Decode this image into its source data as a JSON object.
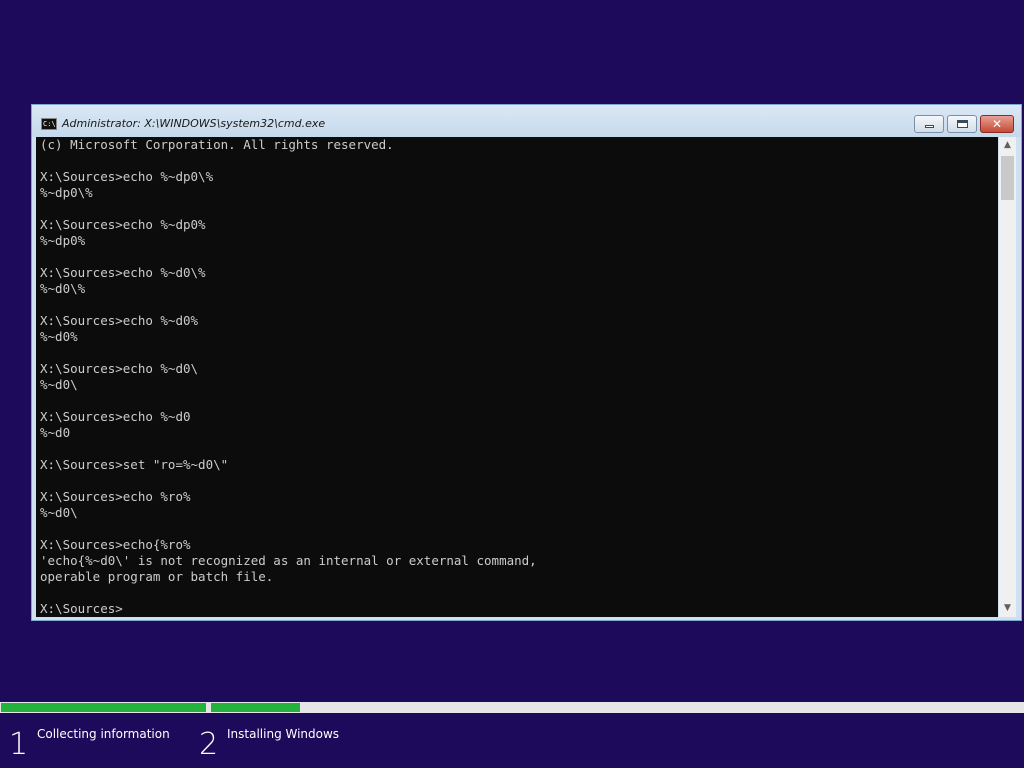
{
  "window": {
    "title": "Administrator: X:\\WINDOWS\\system32\\cmd.exe",
    "icon": "cmd-console-icon",
    "icon_text": "C:\\",
    "buttons": {
      "minimize": "minimize-icon",
      "maximize": "maximize-icon",
      "close_glyph": "✕"
    }
  },
  "console": {
    "lines": [
      "(c) Microsoft Corporation. All rights reserved.",
      "",
      "X:\\Sources>echo %~dp0\\%",
      "%~dp0\\%",
      "",
      "X:\\Sources>echo %~dp0%",
      "%~dp0%",
      "",
      "X:\\Sources>echo %~d0\\%",
      "%~d0\\%",
      "",
      "X:\\Sources>echo %~d0%",
      "%~d0%",
      "",
      "X:\\Sources>echo %~d0\\",
      "%~d0\\",
      "",
      "X:\\Sources>echo %~d0",
      "%~d0",
      "",
      "X:\\Sources>set \"ro=%~d0\\\"",
      "",
      "X:\\Sources>echo %ro%",
      "%~d0\\",
      "",
      "X:\\Sources>echo{%ro%",
      "'echo{%~d0\\' is not recognized as an internal or external command,",
      "operable program or batch file.",
      "",
      "X:\\Sources>"
    ]
  },
  "scrollbar": {
    "up_glyph": "▲",
    "down_glyph": "▼"
  },
  "setup": {
    "steps": [
      {
        "number": "1",
        "label": "Collecting information",
        "progress": 1.0
      },
      {
        "number": "2",
        "label": "Installing Windows",
        "progress": 0.11
      }
    ],
    "colors": {
      "background": "#1e0a5a",
      "progress_fill": "#23b23c",
      "progress_track": "#e6e6e6"
    }
  }
}
